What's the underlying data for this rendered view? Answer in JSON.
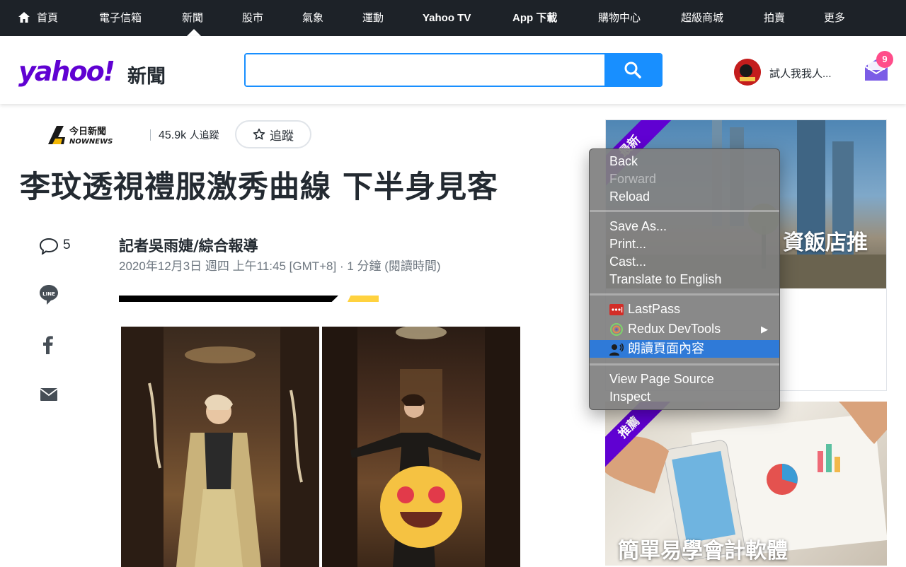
{
  "nav": {
    "items": [
      "首頁",
      "電子信箱",
      "新聞",
      "股市",
      "氣象",
      "運動",
      "Yahoo TV",
      "App 下載",
      "購物中心",
      "超級商城",
      "拍賣",
      "更多"
    ],
    "active": "新聞"
  },
  "header": {
    "logo": "yahoo!",
    "logo_sub": "新聞",
    "search_value": "",
    "user_name": "試人我我人...",
    "mail_badge": "9"
  },
  "article": {
    "publisher": "今日新聞 NOWnews",
    "publisher_line1": "今日新聞",
    "publisher_line2": "NOWNEWS",
    "followers": "45.9k",
    "followers_suffix": "人追蹤",
    "follow_label": "追蹤",
    "title": "李玟透視禮服激秀曲線 下半身見客",
    "comment_count": "5",
    "byline": "記者吳雨婕/綜合報導",
    "dateline": "2020年12月3日 週四 上午11:45 [GMT+8] · 1 分鐘 (閱讀時間)"
  },
  "ads": [
    {
      "ribbon": "最新",
      "caption": "資飯店推"
    },
    {
      "ribbon": "推薦",
      "caption": "簡單易學會計軟體"
    }
  ],
  "context_menu": {
    "back": "Back",
    "forward": "Forward",
    "reload": "Reload",
    "save_as": "Save As...",
    "print": "Print...",
    "cast": "Cast...",
    "translate": "Translate to English",
    "lastpass": "LastPass",
    "redux": "Redux DevTools",
    "read_aloud": "朗讀頁面內容",
    "view_source": "View Page Source",
    "inspect": "Inspect"
  }
}
